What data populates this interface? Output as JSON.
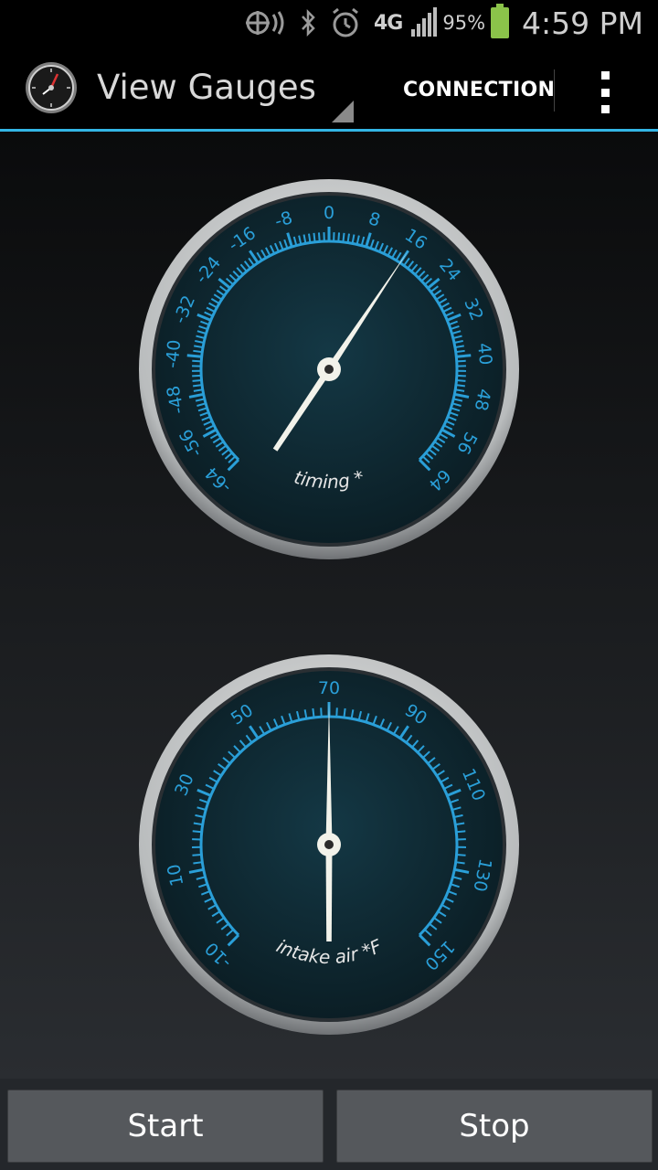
{
  "status_bar": {
    "network": "4G",
    "battery_percent": "95%",
    "battery_level": 0.95,
    "time": "4:59 PM"
  },
  "action_bar": {
    "title": "View Gauges",
    "connection_label": "CONNECTION",
    "icons": [
      "app-gauge-icon",
      "overflow-menu-icon"
    ]
  },
  "gauges": [
    {
      "label": "timing *",
      "tick_labels": [
        "-64",
        "-56",
        "-48",
        "-40",
        "-32",
        "-24",
        "-16",
        "-8",
        "0",
        "8",
        "16",
        "24",
        "32",
        "40",
        "48",
        "56",
        "64"
      ],
      "min": -64,
      "max": 64,
      "needle_value": 16
    },
    {
      "label": "intake air *F",
      "tick_labels": [
        "-10",
        "10",
        "30",
        "50",
        "70",
        "90",
        "110",
        "130",
        "150"
      ],
      "min": -10,
      "max": 150,
      "needle_value": 70
    }
  ],
  "buttons": {
    "start": "Start",
    "stop": "Stop"
  },
  "colors": {
    "accent": "#33b5e5",
    "tick": "#2a9fd8",
    "gauge_face": "#0f2b33",
    "needle": "#f2f2ea"
  }
}
